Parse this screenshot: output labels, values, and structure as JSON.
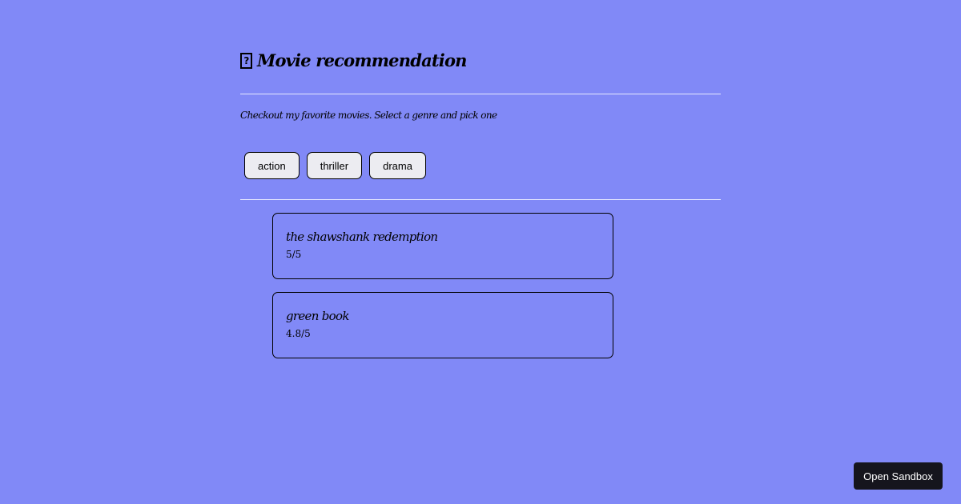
{
  "header": {
    "title_icon": "missing-glyph-icon",
    "title": "Movie recommendation",
    "subtitle": "Checkout my favorite movies. Select a genre and pick one"
  },
  "genres": [
    {
      "label": "action"
    },
    {
      "label": "thriller"
    },
    {
      "label": "drama"
    }
  ],
  "movies": [
    {
      "name": "the shawshank redemption",
      "rating": "5/5"
    },
    {
      "name": "green book",
      "rating": "4.8/5"
    }
  ],
  "sandbox": {
    "label": "Open Sandbox"
  },
  "colors": {
    "background": "#8189f7",
    "button_bg": "#ececf1",
    "sandbox_bg": "#15151d",
    "divider": "#e7e9ff"
  }
}
